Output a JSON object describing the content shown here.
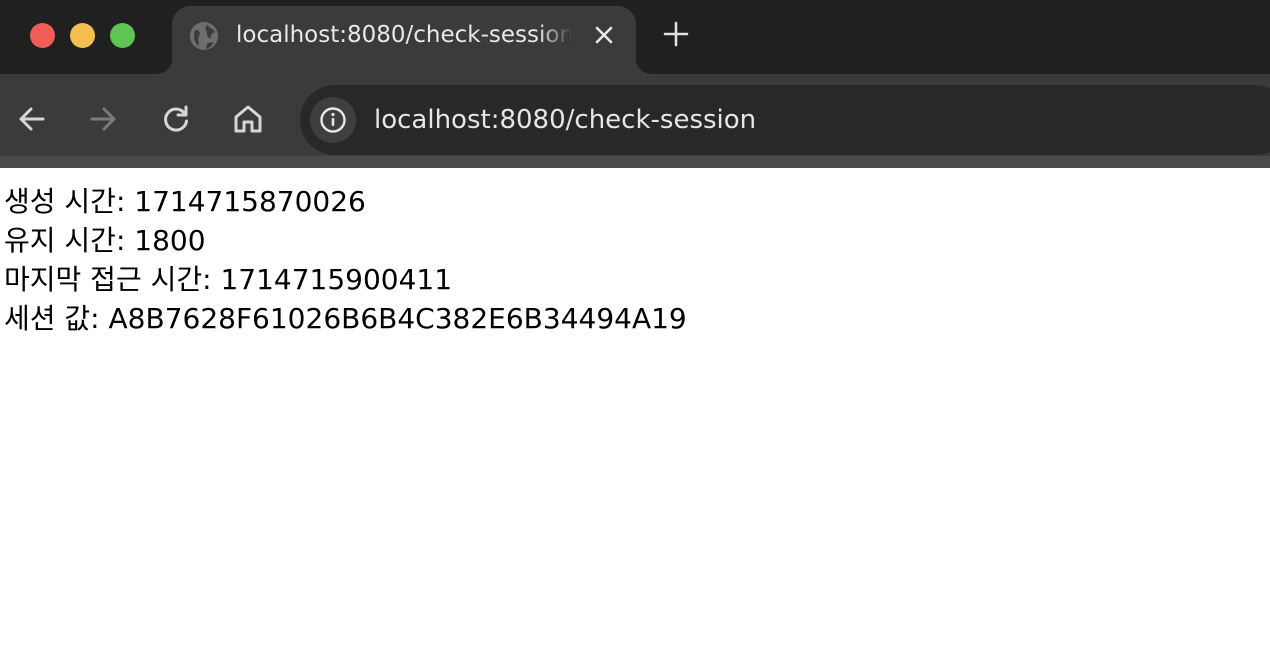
{
  "browser": {
    "tab": {
      "title": "localhost:8080/check-session",
      "favicon": "globe-icon",
      "close_icon": "close-icon"
    },
    "new_tab_icon": "plus-icon",
    "nav": {
      "back_icon": "arrow-left-icon",
      "forward_icon": "arrow-right-icon",
      "reload_icon": "reload-icon",
      "home_icon": "home-icon"
    },
    "address_bar": {
      "site_info_icon": "info-icon",
      "url": "localhost:8080/check-session"
    },
    "colors": {
      "close": "#ee5e57",
      "minimize": "#f4bf4f",
      "zoom": "#5fc453",
      "tabbar_bg": "#202020",
      "toolbar_bg": "#3b3b3b",
      "omnibox_bg": "#282828"
    }
  },
  "page": {
    "lines": [
      "생성 시간: 1714715870026",
      "유지 시간: 1800",
      "마지막 접근 시간: 1714715900411",
      "세션 값: A8B7628F61026B6B4C382E6B34494A19"
    ]
  }
}
